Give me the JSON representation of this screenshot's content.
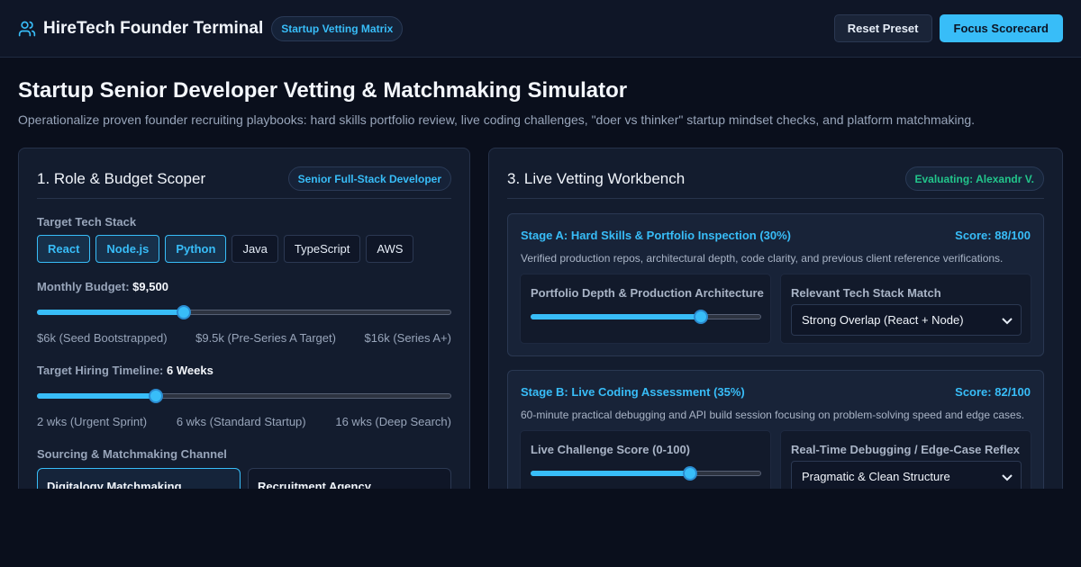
{
  "header": {
    "app_title": "HireTech Founder Terminal",
    "badge": "Startup Vetting Matrix",
    "reset_label": "Reset Preset",
    "focus_label": "Focus Scorecard"
  },
  "page": {
    "title": "Startup Senior Developer Vetting & Matchmaking Simulator",
    "subtitle": "Operationalize proven founder recruiting playbooks: hard skills portfolio review, live coding challenges, \"doer vs thinker\" startup mindset checks, and platform matchmaking."
  },
  "scoper": {
    "title": "1. Role & Budget Scoper",
    "role_badge": "Senior Full-Stack Developer",
    "stack_label": "Target Tech Stack",
    "stack": [
      {
        "label": "React",
        "selected": true
      },
      {
        "label": "Node.js",
        "selected": true
      },
      {
        "label": "Python",
        "selected": true
      },
      {
        "label": "Java",
        "selected": false
      },
      {
        "label": "TypeScript",
        "selected": false
      },
      {
        "label": "AWS",
        "selected": false
      }
    ],
    "budget_label": "Monthly Budget:",
    "budget_value": "$9,500",
    "budget_level": 0.354,
    "budget_scale": [
      "$6k (Seed Bootstrapped)",
      "$9.5k (Pre-Series A Target)",
      "$16k (Series A+)"
    ],
    "timeline_label": "Target Hiring Timeline:",
    "timeline_value": "6 Weeks",
    "timeline_level": 0.286,
    "timeline_scale": [
      "2 wks (Urgent Sprint)",
      "6 wks (Standard Startup)",
      "16 wks (Deep Search)"
    ],
    "channel_label": "Sourcing & Matchmaking Channel",
    "channels": [
      {
        "label": "Digitalogy Matchmaking",
        "selected": true
      },
      {
        "label": "Recruitment Agency",
        "selected": false
      }
    ]
  },
  "workbench": {
    "title": "3. Live Vetting Workbench",
    "evaluating": "Evaluating: Alexandr V.",
    "stage_a": {
      "title": "Stage A: Hard Skills & Portfolio Inspection (30%)",
      "score": "Score: 88/100",
      "desc": "Verified production repos, architectural depth, code clarity, and previous client reference verifications.",
      "slider_label": "Portfolio Depth & Production Architecture",
      "slider_level": 0.74,
      "select_label": "Relevant Tech Stack Match",
      "select_value": "Strong Overlap (React + Node)"
    },
    "stage_b": {
      "title": "Stage B: Live Coding Assessment (35%)",
      "score": "Score: 82/100",
      "desc": "60-minute practical debugging and API build session focusing on problem-solving speed and edge cases.",
      "slider_label": "Live Challenge Score (0-100)",
      "slider_level": 0.69,
      "select_label": "Real-Time Debugging / Edge-Case Reflex",
      "select_value": "Pragmatic & Clean Structure"
    }
  },
  "colors": {
    "accent": "#38bdf8",
    "success": "#22c58b",
    "background": "#0a0f1c",
    "panel": "#131c2e"
  }
}
